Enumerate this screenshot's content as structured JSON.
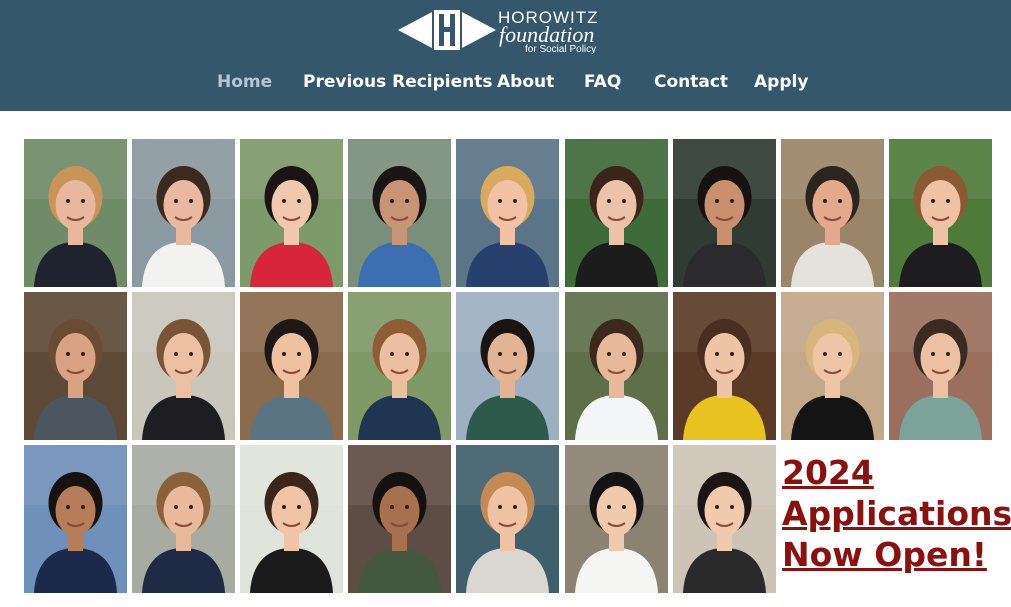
{
  "logo": {
    "line1": "HOROWITZ",
    "line2": "foundation",
    "line3": "for Social Policy",
    "mark_icon": "horowitz-h-logo-icon"
  },
  "nav": {
    "items": [
      {
        "label": "Home",
        "active": true
      },
      {
        "label": "Previous Recipients",
        "active": false
      },
      {
        "label": "About",
        "active": false
      },
      {
        "label": "FAQ",
        "active": false
      },
      {
        "label": "Contact",
        "active": false
      },
      {
        "label": "Apply",
        "active": false
      }
    ]
  },
  "colors": {
    "header_bg": "#35576b",
    "nav_active": "#b4c6d2",
    "cta": "#8b1010"
  },
  "photos": [
    {
      "bg": "#6f8b68",
      "skin": "#e7b79e",
      "hair": "#c8945a",
      "shirt": "#1f2330"
    },
    {
      "bg": "#8a9aa0",
      "skin": "#e9b8a0",
      "hair": "#3d2a1f",
      "shirt": "#f2f2f0"
    },
    {
      "bg": "#7d9a6a",
      "skin": "#f0c8ad",
      "hair": "#1a1414",
      "shirt": "#d7263b"
    },
    {
      "bg": "#7a8f7a",
      "skin": "#c89476",
      "hair": "#1b1613",
      "shirt": "#3c6fb2"
    },
    {
      "bg": "#5b7487",
      "skin": "#f1c2a6",
      "hair": "#d8aa5e",
      "shirt": "#27406e"
    },
    {
      "bg": "#3f6a3a",
      "skin": "#ecc3a8",
      "hair": "#3b2418",
      "shirt": "#1c1c1c"
    },
    {
      "bg": "#2f3b33",
      "skin": "#c99070",
      "hair": "#161210",
      "shirt": "#2b2b2e"
    },
    {
      "bg": "#9b8568",
      "skin": "#e2a98c",
      "hair": "#2d241e",
      "shirt": "#e5e1dc"
    },
    {
      "bg": "#4f7b3a",
      "skin": "#efc2a4",
      "hair": "#8a5a36",
      "shirt": "#1d1d1f"
    },
    {
      "bg": "#5c4a36",
      "skin": "#d9a283",
      "hair": "#6a4c33",
      "shirt": "#4c5660"
    },
    {
      "bg": "#c9c6bc",
      "skin": "#ecc0a3",
      "hair": "#7a5436",
      "shirt": "#1e1e22"
    },
    {
      "bg": "#8a6b4d",
      "skin": "#eec1a0",
      "hair": "#1e1715",
      "shirt": "#5a7481"
    },
    {
      "bg": "#7f9a66",
      "skin": "#ecbfa3",
      "hair": "#8e5c36",
      "shirt": "#1f3550"
    },
    {
      "bg": "#9db0c2",
      "skin": "#e3b493",
      "hair": "#1a1512",
      "shirt": "#2d5a4a"
    },
    {
      "bg": "#5e6f4a",
      "skin": "#e8b89a",
      "hair": "#3c2a1d",
      "shirt": "#f4f5f7"
    },
    {
      "bg": "#5b3b27",
      "skin": "#eec4a6",
      "hair": "#4a2e1f",
      "shirt": "#e8c21f"
    },
    {
      "bg": "#c3a889",
      "skin": "#efc5a7",
      "hair": "#d6b67c",
      "shirt": "#141414"
    },
    {
      "bg": "#9a6f5e",
      "skin": "#ecc1a3",
      "hair": "#3a2a22",
      "shirt": "#7ba39a"
    },
    {
      "bg": "#6f90b8",
      "skin": "#b57d5a",
      "hair": "#17120f",
      "shirt": "#1b2a4a"
    },
    {
      "bg": "#a8aba2",
      "skin": "#e9b99b",
      "hair": "#8a6138",
      "shirt": "#1f2a44"
    },
    {
      "bg": "#dfe3da",
      "skin": "#f0c4a7",
      "hair": "#3a261a",
      "shirt": "#1b1b1b"
    },
    {
      "bg": "#5e4d44",
      "skin": "#a7704f",
      "hair": "#151110",
      "shirt": "#43583f"
    },
    {
      "bg": "#3f5f6c",
      "skin": "#eec2a3",
      "hair": "#c48a55",
      "shirt": "#d9d7d0"
    },
    {
      "bg": "#8c8272",
      "skin": "#f0caad",
      "hair": "#141212",
      "shirt": "#f5f5f3"
    },
    {
      "bg": "#cdc4b6",
      "skin": "#f1c9ad",
      "hair": "#1c1513",
      "shirt": "#2a2a2a"
    }
  ],
  "cta": {
    "line1": "2024",
    "line2": "Applications",
    "line3": "Now Open!"
  }
}
